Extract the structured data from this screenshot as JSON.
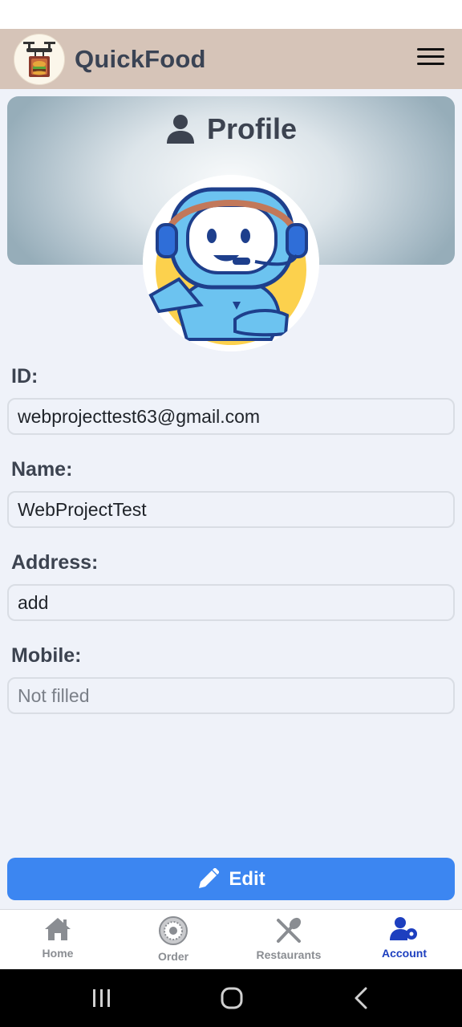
{
  "app": {
    "title": "QuickFood",
    "logo_icon": "drone-delivery-icon",
    "header_color": "#d6c4b8"
  },
  "profile": {
    "heading": "Profile",
    "heading_icon": "user-icon",
    "avatar": "robot-headset-avatar"
  },
  "fields": {
    "id": {
      "label": "ID:",
      "value": "webprojecttest63@gmail.com"
    },
    "name": {
      "label": "Name:",
      "value": "WebProjectTest"
    },
    "address": {
      "label": "Address:",
      "value": "add"
    },
    "mobile": {
      "label": "Mobile:",
      "value": "Not filled"
    }
  },
  "actions": {
    "edit_label": "Edit",
    "edit_icon": "pencil-icon",
    "accent_color": "#3c86f1"
  },
  "bottom_nav": {
    "items": [
      {
        "label": "Home",
        "icon": "home-icon",
        "active": false
      },
      {
        "label": "Order",
        "icon": "order-icon",
        "active": false
      },
      {
        "label": "Restaurants",
        "icon": "fork-spoon-icon",
        "active": false
      },
      {
        "label": "Account",
        "icon": "user-settings-icon",
        "active": true
      }
    ],
    "active_color": "#1d3fbf"
  },
  "system_nav": {
    "buttons": [
      "recent-apps-icon",
      "home-circle-icon",
      "back-icon"
    ]
  }
}
